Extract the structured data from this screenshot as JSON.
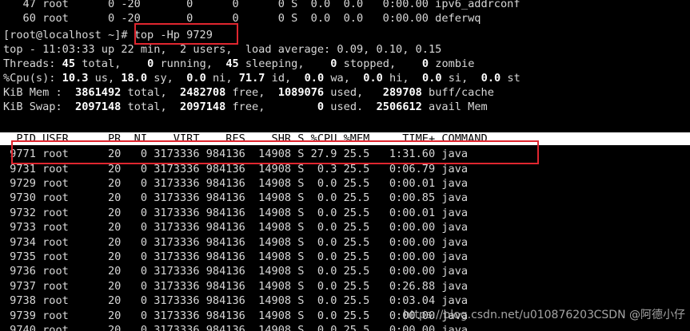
{
  "prev_rows": [
    "   47 root      0 -20       0      0      0 S  0.0  0.0   0:00.00 ipv6_addrconf",
    "   60 root      0 -20       0      0      0 S  0.0  0.0   0:00.00 deferwq"
  ],
  "command": {
    "prompt": "[root@localhost ~]# ",
    "text": "top -Hp 9729"
  },
  "summary": {
    "uptime_line": "top - 11:03:33 up 22 min,  2 users,  load average: 0.09, 0.10, 0.15",
    "threads": {
      "label": "Threads:",
      "total": "45",
      "total_label": " total,",
      "running": "0",
      "running_label": " running,",
      "sleeping": "45",
      "sleeping_label": " sleeping,",
      "stopped": "0",
      "stopped_label": " stopped,",
      "zombie": "0",
      "zombie_label": " zombie"
    },
    "cpu": {
      "label": "%Cpu(s):",
      "us": "10.3",
      "us_label": " us,",
      "sy": "18.0",
      "sy_label": " sy,",
      "ni": "0.0",
      "ni_label": " ni,",
      "id": "71.7",
      "id_label": " id,",
      "wa": "0.0",
      "wa_label": " wa,",
      "hi": "0.0",
      "hi_label": " hi,",
      "si": "0.0",
      "si_label": " si,",
      "st": "0.0",
      "st_label": " st"
    },
    "mem": {
      "label": "KiB Mem :",
      "total": "3861492",
      "total_label": " total,",
      "free": "2482708",
      "free_label": " free,",
      "used": "1089076",
      "used_label": " used,",
      "buff": "289708",
      "buff_label": " buff/cache"
    },
    "swap": {
      "label": "KiB Swap:",
      "total": "2097148",
      "total_label": " total,",
      "free": "2097148",
      "free_label": " free,",
      "used": "0",
      "used_label": " used.",
      "avail": "2506612",
      "avail_label": " avail Mem"
    }
  },
  "table": {
    "header": "  PID USER      PR  NI    VIRT    RES    SHR S %CPU %MEM     TIME+ COMMAND",
    "rows": [
      " 9771 root      20   0 3173336 984136  14908 S 27.9 25.5   1:31.60 java",
      " 9731 root      20   0 3173336 984136  14908 S  0.3 25.5   0:06.79 java",
      " 9729 root      20   0 3173336 984136  14908 S  0.0 25.5   0:00.01 java",
      " 9730 root      20   0 3173336 984136  14908 S  0.0 25.5   0:00.85 java",
      " 9732 root      20   0 3173336 984136  14908 S  0.0 25.5   0:00.01 java",
      " 9733 root      20   0 3173336 984136  14908 S  0.0 25.5   0:00.00 java",
      " 9734 root      20   0 3173336 984136  14908 S  0.0 25.5   0:00.00 java",
      " 9735 root      20   0 3173336 984136  14908 S  0.0 25.5   0:00.00 java",
      " 9736 root      20   0 3173336 984136  14908 S  0.0 25.5   0:00.00 java",
      " 9737 root      20   0 3173336 984136  14908 S  0.0 25.5   0:26.88 java",
      " 9738 root      20   0 3173336 984136  14908 S  0.0 25.5   0:03.04 java",
      " 9739 root      20   0 3173336 984136  14908 S  0.0 25.5   0:00.00 java",
      " 9740 root      20   0 3173336 984136  14908 S  0.0 25.5   0:00.00 java"
    ]
  },
  "watermark": "https://blog.csdn.net/u010876203",
  "watermark_overlay": "CSDN @阿德小仔",
  "colors": {
    "background": "#000000",
    "foreground": "#d8d8d8",
    "highlight_box": "#e0262f",
    "header_bar": "#ffffff"
  }
}
